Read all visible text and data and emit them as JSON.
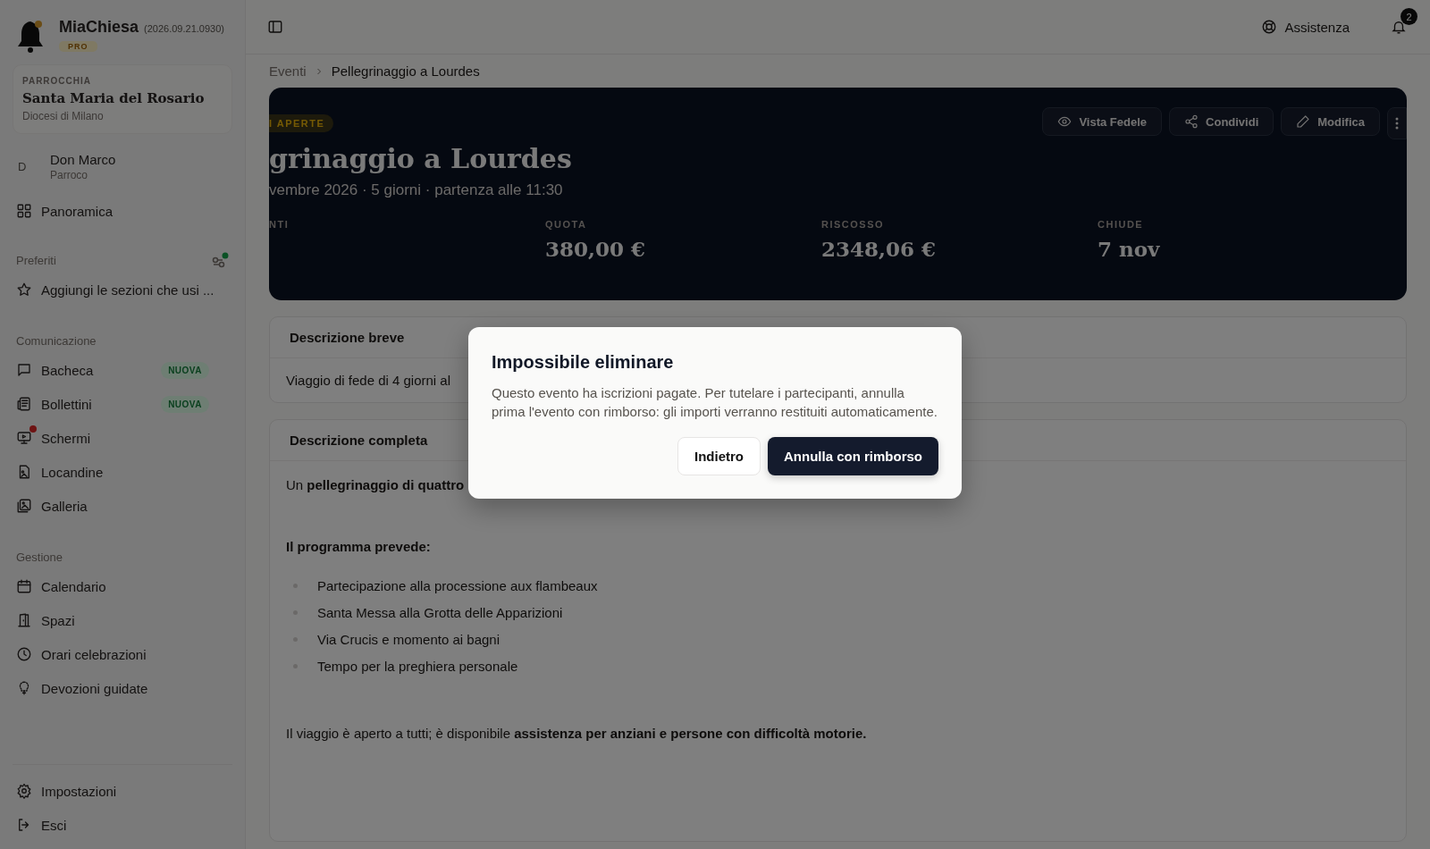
{
  "app": {
    "name": "MiaChiesa",
    "version": "(2026.09.21.0930)",
    "plan": "PRO"
  },
  "parish": {
    "label": "PARROCCHIA",
    "name": "Santa Maria del Rosario",
    "diocese": "Diocesi di Milano"
  },
  "user": {
    "initial": "D",
    "name": "Don Marco",
    "role": "Parroco"
  },
  "nav_top": [
    {
      "label": "Panoramica",
      "alert": false
    }
  ],
  "favorites": {
    "title": "Preferiti",
    "items": [
      {
        "label": "Aggiungi le sezioni che usi ...",
        "alert": false
      }
    ]
  },
  "sections": [
    {
      "title": "Comunicazione",
      "items": [
        {
          "label": "Bacheca",
          "badge": "NUOVA",
          "alert": false
        },
        {
          "label": "Bollettini",
          "badge": "NUOVA",
          "alert": false
        },
        {
          "label": "Schermi",
          "alert": true
        },
        {
          "label": "Locandine",
          "alert": false
        },
        {
          "label": "Galleria",
          "alert": false
        }
      ]
    },
    {
      "title": "Gestione",
      "items": [
        {
          "label": "Calendario",
          "alert": false
        },
        {
          "label": "Spazi",
          "alert": false
        },
        {
          "label": "Orari celebrazioni",
          "alert": false
        },
        {
          "label": "Devozioni guidate",
          "alert": false
        }
      ]
    }
  ],
  "footer_items": [
    {
      "label": "Impostazioni",
      "alert": false
    },
    {
      "label": "Esci",
      "alert": false
    }
  ],
  "topbar": {
    "help": "Assistenza",
    "notifications": "2"
  },
  "breadcrumb": [
    "Eventi",
    "Pellegrinaggio a Lourdes"
  ],
  "hero": {
    "status": "I APERTE",
    "title": "grinaggio a Lourdes",
    "subtitle": "vembre 2026 · 5 giorni · partenza alle 11:30",
    "actions": [
      {
        "label": "Vista Fedele"
      },
      {
        "label": "Condividi"
      },
      {
        "label": "Modifica"
      }
    ],
    "stats": [
      {
        "label": "NTI"
      },
      {
        "label": "QUOTA",
        "value": "380,00 €"
      },
      {
        "label": "RISCOSSO",
        "value": "2348,06 €"
      },
      {
        "label": "CHIUDE",
        "value": "7 nov"
      }
    ]
  },
  "short_description": {
    "title": "Descrizione breve",
    "text": "Viaggio di fede di 4 giorni al"
  },
  "full_description": {
    "title": "Descrizione completa",
    "blocks": [
      {
        "kind": "paragraph",
        "text": "Un **pellegrinaggio di quattro**"
      },
      {
        "kind": "heading",
        "text": "Il programma prevede:"
      },
      {
        "kind": "list",
        "items": [
          "Partecipazione alla processione aux flambeaux",
          "Santa Messa alla Grotta delle Apparizioni",
          "Via Crucis e momento ai bagni",
          "Tempo per la preghiera personale"
        ]
      },
      {
        "kind": "paragraph",
        "text": "Il viaggio è aperto a tutti; è disponibile **assistenza per anziani e persone con difficoltà motorie.**"
      }
    ]
  },
  "dialog": {
    "title": "Impossibile eliminare",
    "text": "Questo evento ha iscrizioni pagate. Per tutelare i partecipanti, annulla prima l'evento con rimborso: gli importi verranno restituiti automaticamente.",
    "buttons": [
      {
        "label": "Indietro",
        "kind": "secondary"
      },
      {
        "label": "Annulla con rimborso",
        "kind": "primary"
      }
    ]
  }
}
